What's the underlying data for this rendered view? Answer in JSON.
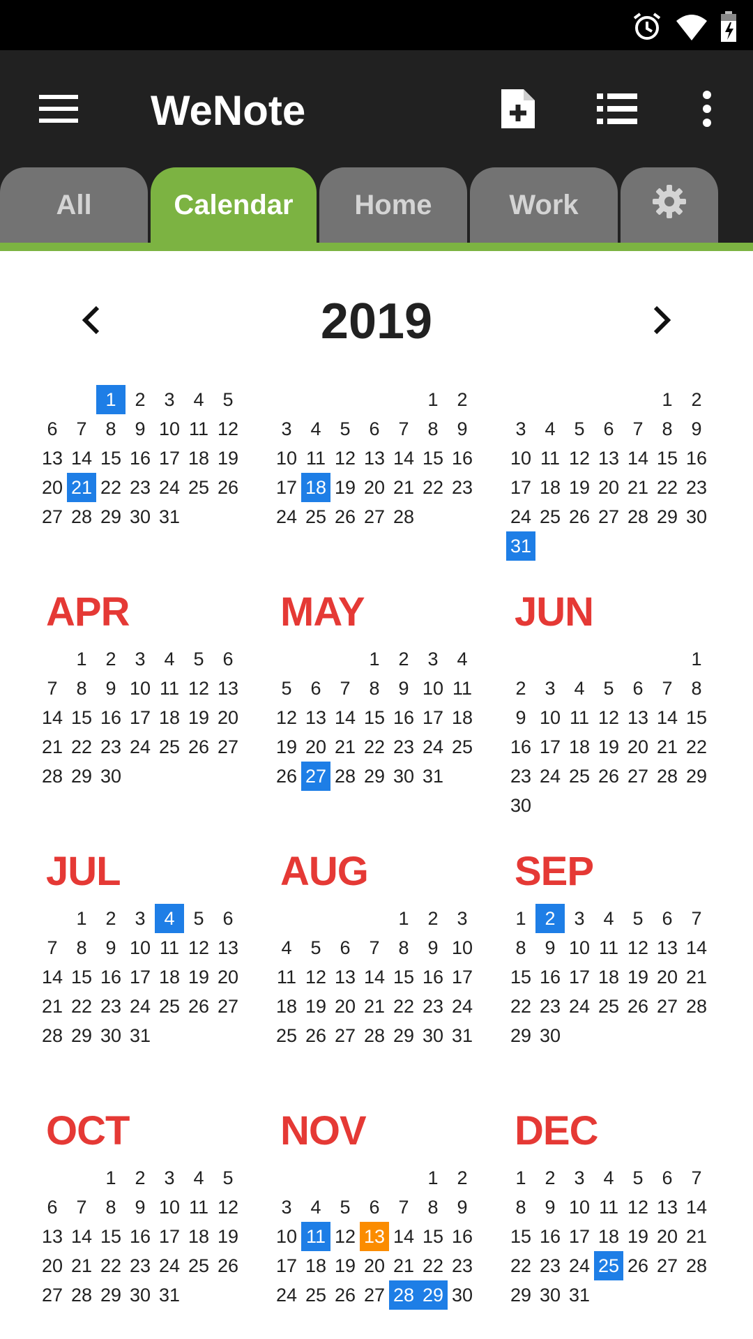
{
  "app": {
    "title": "WeNote"
  },
  "status_bar": {
    "icons": [
      "alarm-icon",
      "wifi-icon",
      "battery-charging-icon"
    ]
  },
  "toolbar": {
    "icons": [
      "menu-icon",
      "new-note-icon",
      "list-view-icon",
      "more-vert-icon"
    ]
  },
  "tabs": [
    {
      "label": "All",
      "active": false
    },
    {
      "label": "Calendar",
      "active": true
    },
    {
      "label": "Home",
      "active": false
    },
    {
      "label": "Work",
      "active": false
    },
    {
      "label": "",
      "icon": "gear-icon",
      "active": false
    }
  ],
  "colors": {
    "accent": "#7cb342",
    "month_title": "#e53935",
    "note_day": "#1e7ee6",
    "today": "#fb8c00",
    "app_bar": "#212121"
  },
  "calendar": {
    "year": "2019",
    "months": [
      {
        "name": "",
        "start": 1,
        "days": 31,
        "highlights": [
          1,
          21
        ],
        "today": []
      },
      {
        "name": "",
        "start": 4,
        "days": 28,
        "highlights": [
          18
        ],
        "today": []
      },
      {
        "name": "",
        "start": 4,
        "days": 31,
        "highlights": [
          31
        ],
        "today": []
      },
      {
        "name": "APR",
        "start": 0,
        "days": 30,
        "highlights": [],
        "today": []
      },
      {
        "name": "MAY",
        "start": 2,
        "days": 31,
        "highlights": [
          27
        ],
        "today": []
      },
      {
        "name": "JUN",
        "start": 5,
        "days": 30,
        "highlights": [],
        "today": []
      },
      {
        "name": "JUL",
        "start": 0,
        "days": 31,
        "highlights": [
          4
        ],
        "today": []
      },
      {
        "name": "AUG",
        "start": 3,
        "days": 31,
        "highlights": [],
        "today": []
      },
      {
        "name": "SEP",
        "start": -1,
        "days": 30,
        "highlights": [
          2
        ],
        "today": []
      },
      {
        "name": "OCT",
        "start": 1,
        "days": 31,
        "highlights": [],
        "today": []
      },
      {
        "name": "NOV",
        "start": 4,
        "days": 30,
        "highlights": [
          11,
          28,
          29
        ],
        "today": [
          13
        ]
      },
      {
        "name": "DEC",
        "start": -1,
        "days": 31,
        "highlights": [
          25
        ],
        "today": []
      }
    ]
  }
}
